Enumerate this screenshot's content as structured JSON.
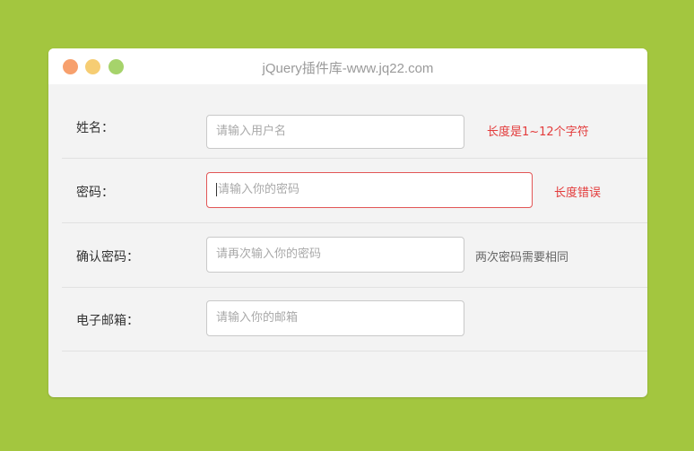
{
  "window": {
    "title": "jQuery插件库-www.jq22.com"
  },
  "form": {
    "rows": [
      {
        "label": "姓名：",
        "placeholder": "请输入用户名",
        "message": "长度是1~12个字符"
      },
      {
        "label": "密码：",
        "placeholder": "请输入你的密码",
        "message": "长度错误"
      },
      {
        "label": "确认密码：",
        "placeholder": "请再次输入你的密码",
        "message": "两次密码需要相同"
      },
      {
        "label": "电子邮箱：",
        "placeholder": "请输入你的邮箱",
        "message": ""
      }
    ]
  },
  "colors": {
    "background": "#a3c63f",
    "error": "#e33b3b",
    "traffic_red": "#f7a06d",
    "traffic_yellow": "#f6cd73",
    "traffic_green": "#a6d36b"
  }
}
